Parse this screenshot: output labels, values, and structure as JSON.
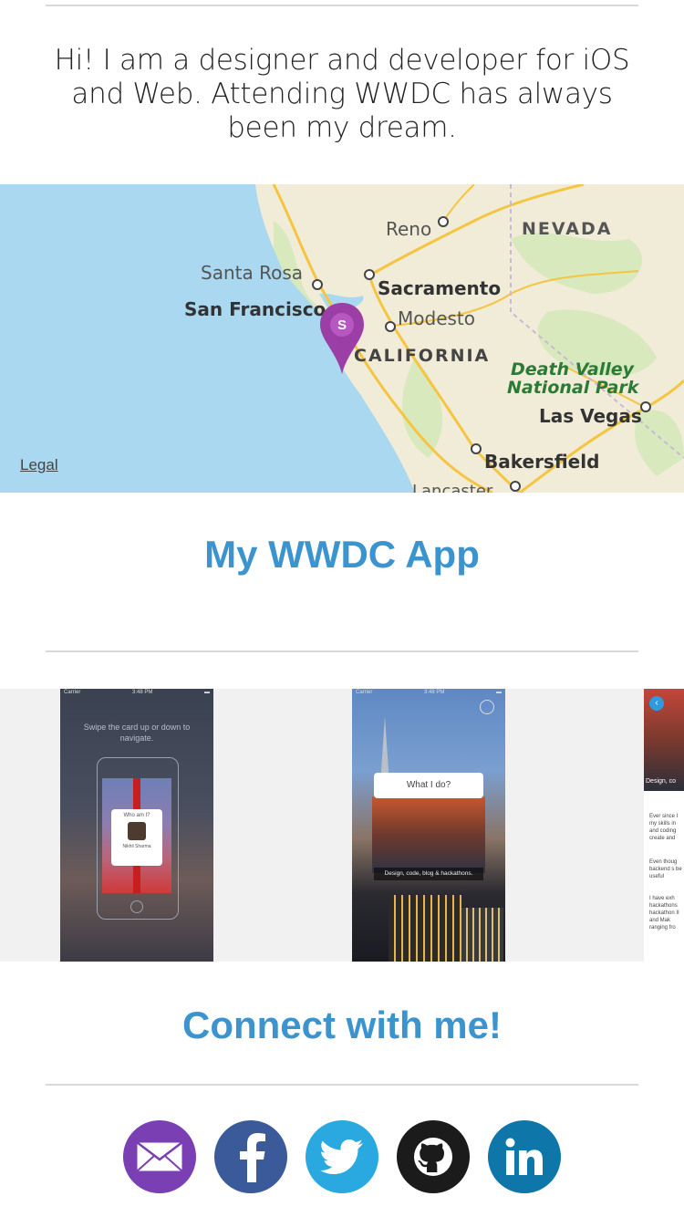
{
  "intro": {
    "text": "Hi! I am a designer and developer for iOS and Web. Attending WWDC has always been my dream."
  },
  "map": {
    "labels": {
      "reno": "Reno",
      "nevada": "NEVADA",
      "santa_rosa": "Santa Rosa",
      "sacramento": "Sacramento",
      "san_francisco": "San Francisco",
      "modesto": "Modesto",
      "california": "CALIFORNIA",
      "death_valley_1": "Death Valley",
      "death_valley_2": "National Park",
      "las_vegas": "Las Vegas",
      "bakersfield": "Bakersfield",
      "lancaster": "Lancaster"
    },
    "pin_letter": "S",
    "legal": "Legal",
    "colors": {
      "water": "#a9d8f0",
      "land": "#f1ecd8",
      "park": "#cfe8b4",
      "road": "#f5c542",
      "pin": "#9b3fa6"
    }
  },
  "app_section": {
    "title": "My WWDC App"
  },
  "screens": {
    "one": {
      "carrier": "Carrier",
      "time": "3:48 PM",
      "hint": "Swipe the card up or down to navigate.",
      "card_title": "Who am I?",
      "card_caption": "Nikhil Sharma"
    },
    "two": {
      "carrier": "Carrier",
      "time": "3:48 PM",
      "card_title": "What I do?",
      "caption": "Design, code, blog & hackathons."
    },
    "three": {
      "caption": "Design, co",
      "para1": "Ever since I my skills in and coding create and",
      "para2": "Even thoug backend s be useful",
      "para3": "I have exh hackathons hackathon II and Mak ranging fro"
    }
  },
  "connect": {
    "title": "Connect with me!"
  },
  "social": [
    {
      "name": "email",
      "icon": "email-icon",
      "color": "#7a3fb3"
    },
    {
      "name": "facebook",
      "icon": "facebook-icon",
      "color": "#3b5a9a"
    },
    {
      "name": "twitter",
      "icon": "twitter-icon",
      "color": "#2aa9e0"
    },
    {
      "name": "github",
      "icon": "github-icon",
      "color": "#1b1b1b"
    },
    {
      "name": "linkedin",
      "icon": "linkedin-icon",
      "color": "#0e76a8"
    }
  ]
}
